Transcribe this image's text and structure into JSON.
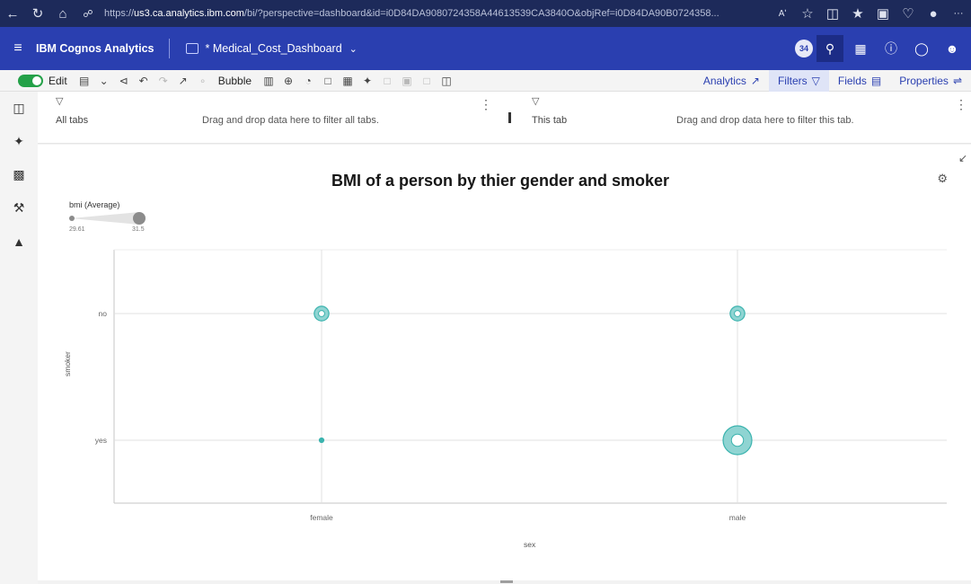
{
  "browser": {
    "url_prefix": "https://",
    "url_host": "us3.ca.analytics.ibm.com",
    "url_rest": "/bi/?perspective=dashboard&id=i0D84DA9080724358A44613539CA3840O&objRef=i0D84DA90B0724358...",
    "read_aloud": "Aʹ",
    "more": "···"
  },
  "app": {
    "brand": "IBM Cognos Analytics",
    "dashboard_name": "* Medical_Cost_Dashboard",
    "notifications_count": "34"
  },
  "toolbar": {
    "edit_label": "Edit",
    "visualization_label": "Bubble",
    "analytics_label": "Analytics",
    "filters_label": "Filters",
    "fields_label": "Fields",
    "properties_label": "Properties"
  },
  "filters": {
    "all_tabs_label": "All tabs",
    "all_tabs_hint": "Drag and drop data here to filter all tabs.",
    "this_tab_label": "This tab",
    "this_tab_hint": "Drag and drop data here to filter this tab."
  },
  "chart_data": {
    "type": "scatter",
    "title": "BMI of a person by thier gender and smoker",
    "xlabel": "sex",
    "ylabel": "smoker",
    "x_categories": [
      "female",
      "male"
    ],
    "y_categories": [
      "no",
      "yes"
    ],
    "size_legend": {
      "title": "bmi (Average)",
      "min": 29.61,
      "max": 31.5
    },
    "points": [
      {
        "x": "female",
        "y": "no",
        "size_estimate": 30.4
      },
      {
        "x": "male",
        "y": "no",
        "size_estimate": 30.4
      },
      {
        "x": "female",
        "y": "yes",
        "size_estimate": 29.61
      },
      {
        "x": "male",
        "y": "yes",
        "size_estimate": 31.5
      }
    ],
    "bubble_color": "#8fd4d2",
    "bubble_stroke": "#3ab3ae",
    "grid": true
  }
}
